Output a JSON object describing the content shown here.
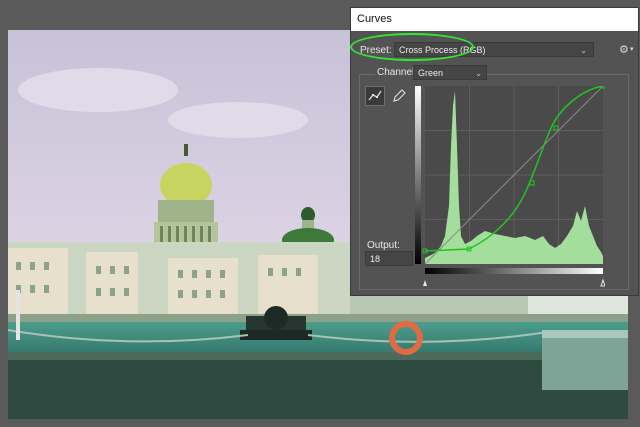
{
  "window": {
    "title": "Curves"
  },
  "preset": {
    "label": "Preset:",
    "value": "Cross Process (RGB)"
  },
  "channel": {
    "label": "Channel:",
    "value": "Green"
  },
  "output": {
    "label": "Output:",
    "value": "18"
  },
  "icons": {
    "settings": "gear-icon",
    "curve_tool": "curve-point-tool-icon",
    "pencil_tool": "pencil-icon"
  },
  "colors": {
    "dialog_bg": "#535353",
    "graph_bg": "#4a4a4a",
    "histogram": "#a8e6a0",
    "curve": "#21c521",
    "highlight": "#33e633"
  },
  "curve_points": [
    {
      "input": 0,
      "output": 18
    },
    {
      "input": 64,
      "output": 21
    },
    {
      "input": 145,
      "output": 105
    },
    {
      "input": 180,
      "output": 195
    },
    {
      "input": 255,
      "output": 255
    }
  ]
}
